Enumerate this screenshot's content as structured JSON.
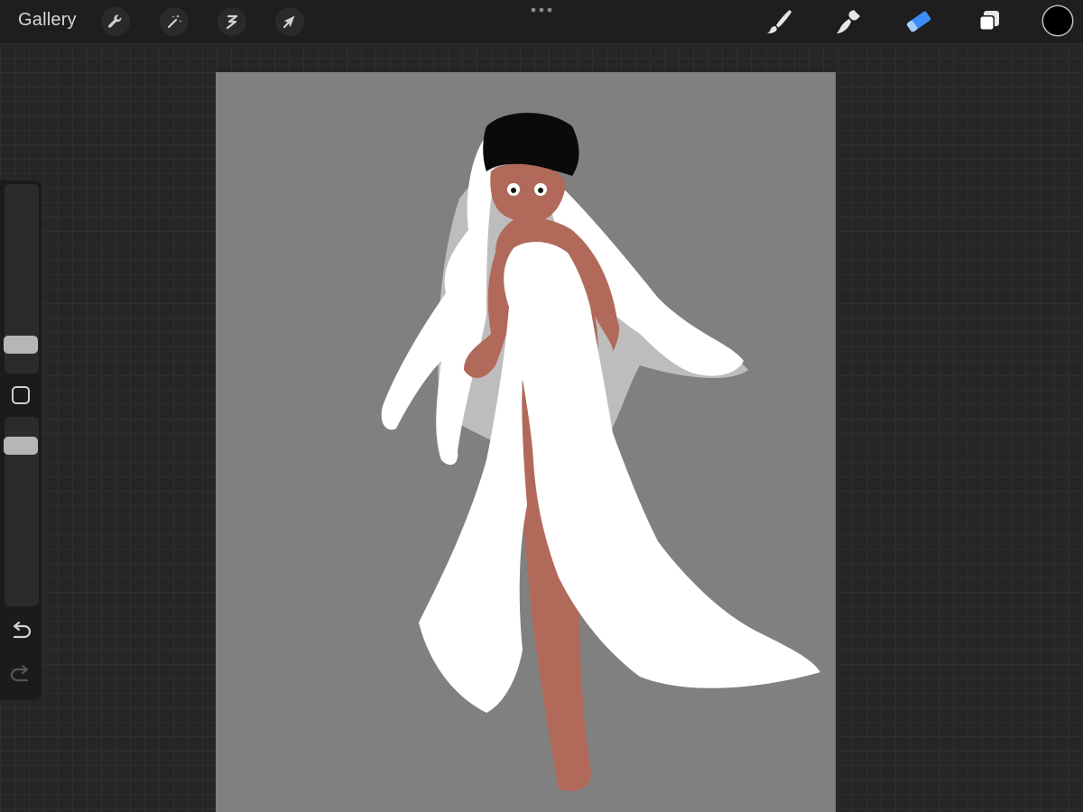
{
  "topbar": {
    "gallery_label": "Gallery",
    "left_tools": [
      "wrench-icon",
      "magic-wand-icon",
      "selection-icon",
      "transform-arrow-icon"
    ],
    "right_tools": [
      "brush-icon",
      "smudge-icon",
      "eraser-icon",
      "layers-icon"
    ],
    "active_tool": "eraser",
    "current_color": "#000000"
  },
  "sidebar": {
    "size_slider_level": 0.38,
    "opacity_slider_level": 0.85
  },
  "colors": {
    "accent": "#3a8ef6",
    "canvas_background": "#808080"
  }
}
